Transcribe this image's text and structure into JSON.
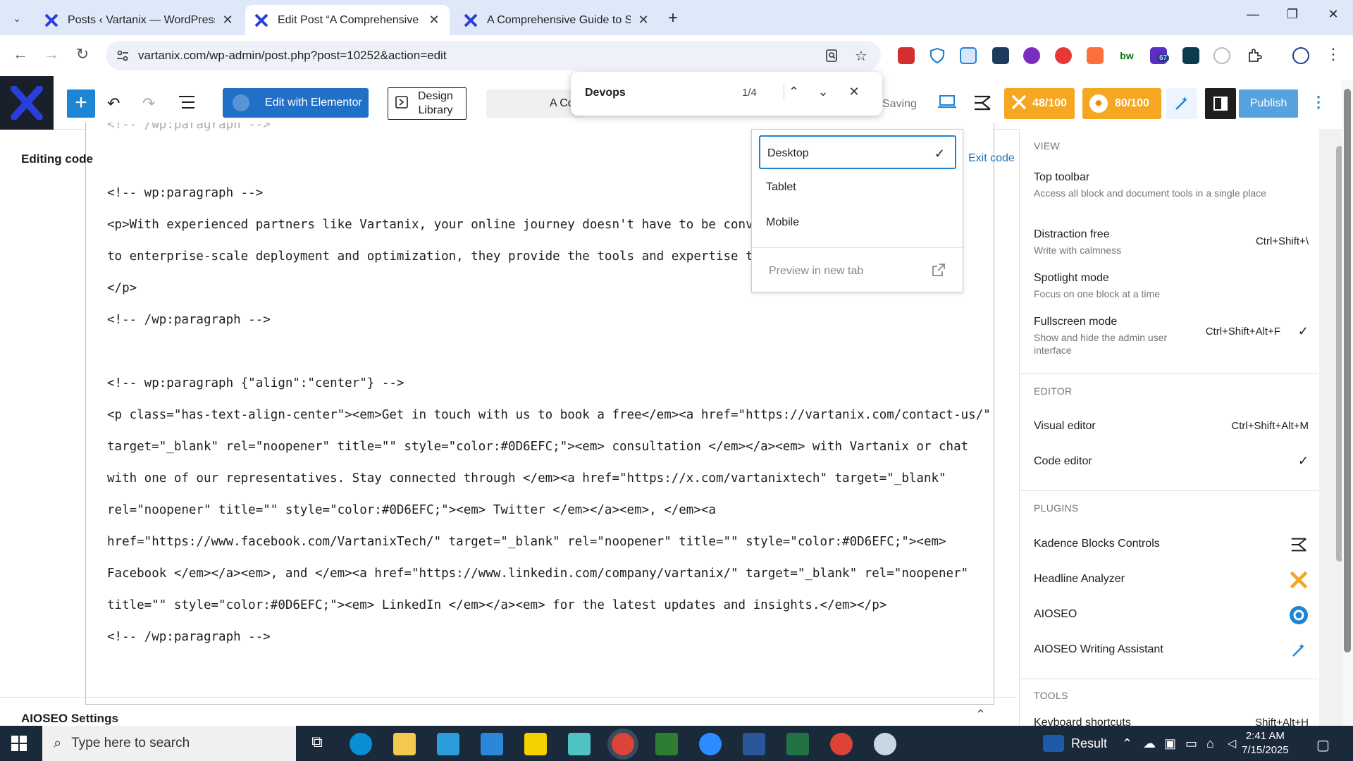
{
  "browser": {
    "tabs": [
      {
        "title": "Posts ‹ Vartanix — WordPress",
        "active": false
      },
      {
        "title": "Edit Post “A Comprehensive Gu",
        "active": true
      },
      {
        "title": "A Comprehensive Guide to Stra",
        "active": false
      }
    ],
    "url": "vartanix.com/wp-admin/post.php?post=10252&action=edit",
    "extensions_badge": "67"
  },
  "find": {
    "query": "Devops",
    "count": "1/4"
  },
  "toolbar": {
    "elementor_label": "Edit with Elementor",
    "design_library_line1": "Design",
    "design_library_line2": "Library",
    "doc_title": "A Co",
    "saving": "Saving",
    "headline_score": "48/100",
    "aioseo_score": "80/100",
    "publish": "Publish"
  },
  "canvas": {
    "editing_label": "Editing code",
    "exit_code": "Exit code",
    "aioseo_settings": "AIOSEO Settings",
    "code_lines": [
      "<!-- /wp:paragraph -->",
      "",
      "<!-- wp:paragraph -->",
      "<p>With experienced partners like Vartanix, your online journey doesn't have to be convol",
      "to enterprise-scale deployment and optimization, they provide the tools and expertise to",
      "</p>",
      "<!-- /wp:paragraph -->",
      "",
      "<!-- wp:paragraph {\"align\":\"center\"} -->",
      "<p class=\"has-text-align-center\"><em>Get in touch with us to book a free</em><a href=\"https://vartanix.com/contact-us/\"",
      "target=\"_blank\" rel=\"noopener\" title=\"\" style=\"color:#0D6EFC;\"><em> consultation </em></a><em> with Vartanix or chat",
      "with one of our representatives. Stay connected through </em><a href=\"https://x.com/vartanixtech\" target=\"_blank\"",
      "rel=\"noopener\" title=\"\" style=\"color:#0D6EFC;\"><em> Twitter </em></a><em>, </em><a",
      "href=\"https://www.facebook.com/VartanixTech/\" target=\"_blank\" rel=\"noopener\" title=\"\" style=\"color:#0D6EFC;\"><em>",
      "Facebook </em></a><em>, and </em><a href=\"https://www.linkedin.com/company/vartanix/\" target=\"_blank\" rel=\"noopener\"",
      "title=\"\" style=\"color:#0D6EFC;\"><em> LinkedIn </em></a><em> for the latest updates and insights.</em></p>",
      "<!-- /wp:paragraph -->"
    ]
  },
  "device_menu": {
    "items": [
      "Desktop",
      "Tablet",
      "Mobile"
    ],
    "selected": "Desktop",
    "preview": "Preview in new tab"
  },
  "options": {
    "view_title": "VIEW",
    "top_toolbar": {
      "label": "Top toolbar",
      "desc": "Access all block and document tools in a single place"
    },
    "distraction_free": {
      "label": "Distraction free",
      "desc": "Write with calmness",
      "shortcut": "Ctrl+Shift+\\"
    },
    "spotlight": {
      "label": "Spotlight mode",
      "desc": "Focus on one block at a time"
    },
    "fullscreen": {
      "label": "Fullscreen mode",
      "desc": "Show and hide the admin user interface",
      "shortcut": "Ctrl+Shift+Alt+F"
    },
    "editor_title": "EDITOR",
    "visual_editor": {
      "label": "Visual editor",
      "shortcut": "Ctrl+Shift+Alt+M"
    },
    "code_editor": {
      "label": "Code editor"
    },
    "plugins_title": "PLUGINS",
    "plugins": [
      "Kadence Blocks Controls",
      "Headline Analyzer",
      "AIOSEO",
      "AIOSEO Writing Assistant"
    ],
    "tools_title": "TOOLS",
    "keyboard_shortcuts": {
      "label": "Keyboard shortcuts",
      "shortcut": "Shift+Alt+H"
    }
  },
  "taskbar": {
    "search_placeholder": "Type here to search",
    "weather": "Result",
    "time": "2:41 AM",
    "date": "7/15/2025"
  },
  "colors": {
    "accent": "#1e84d4",
    "score_orange": "#f5a623",
    "taskbar": "#1b2a3a"
  }
}
